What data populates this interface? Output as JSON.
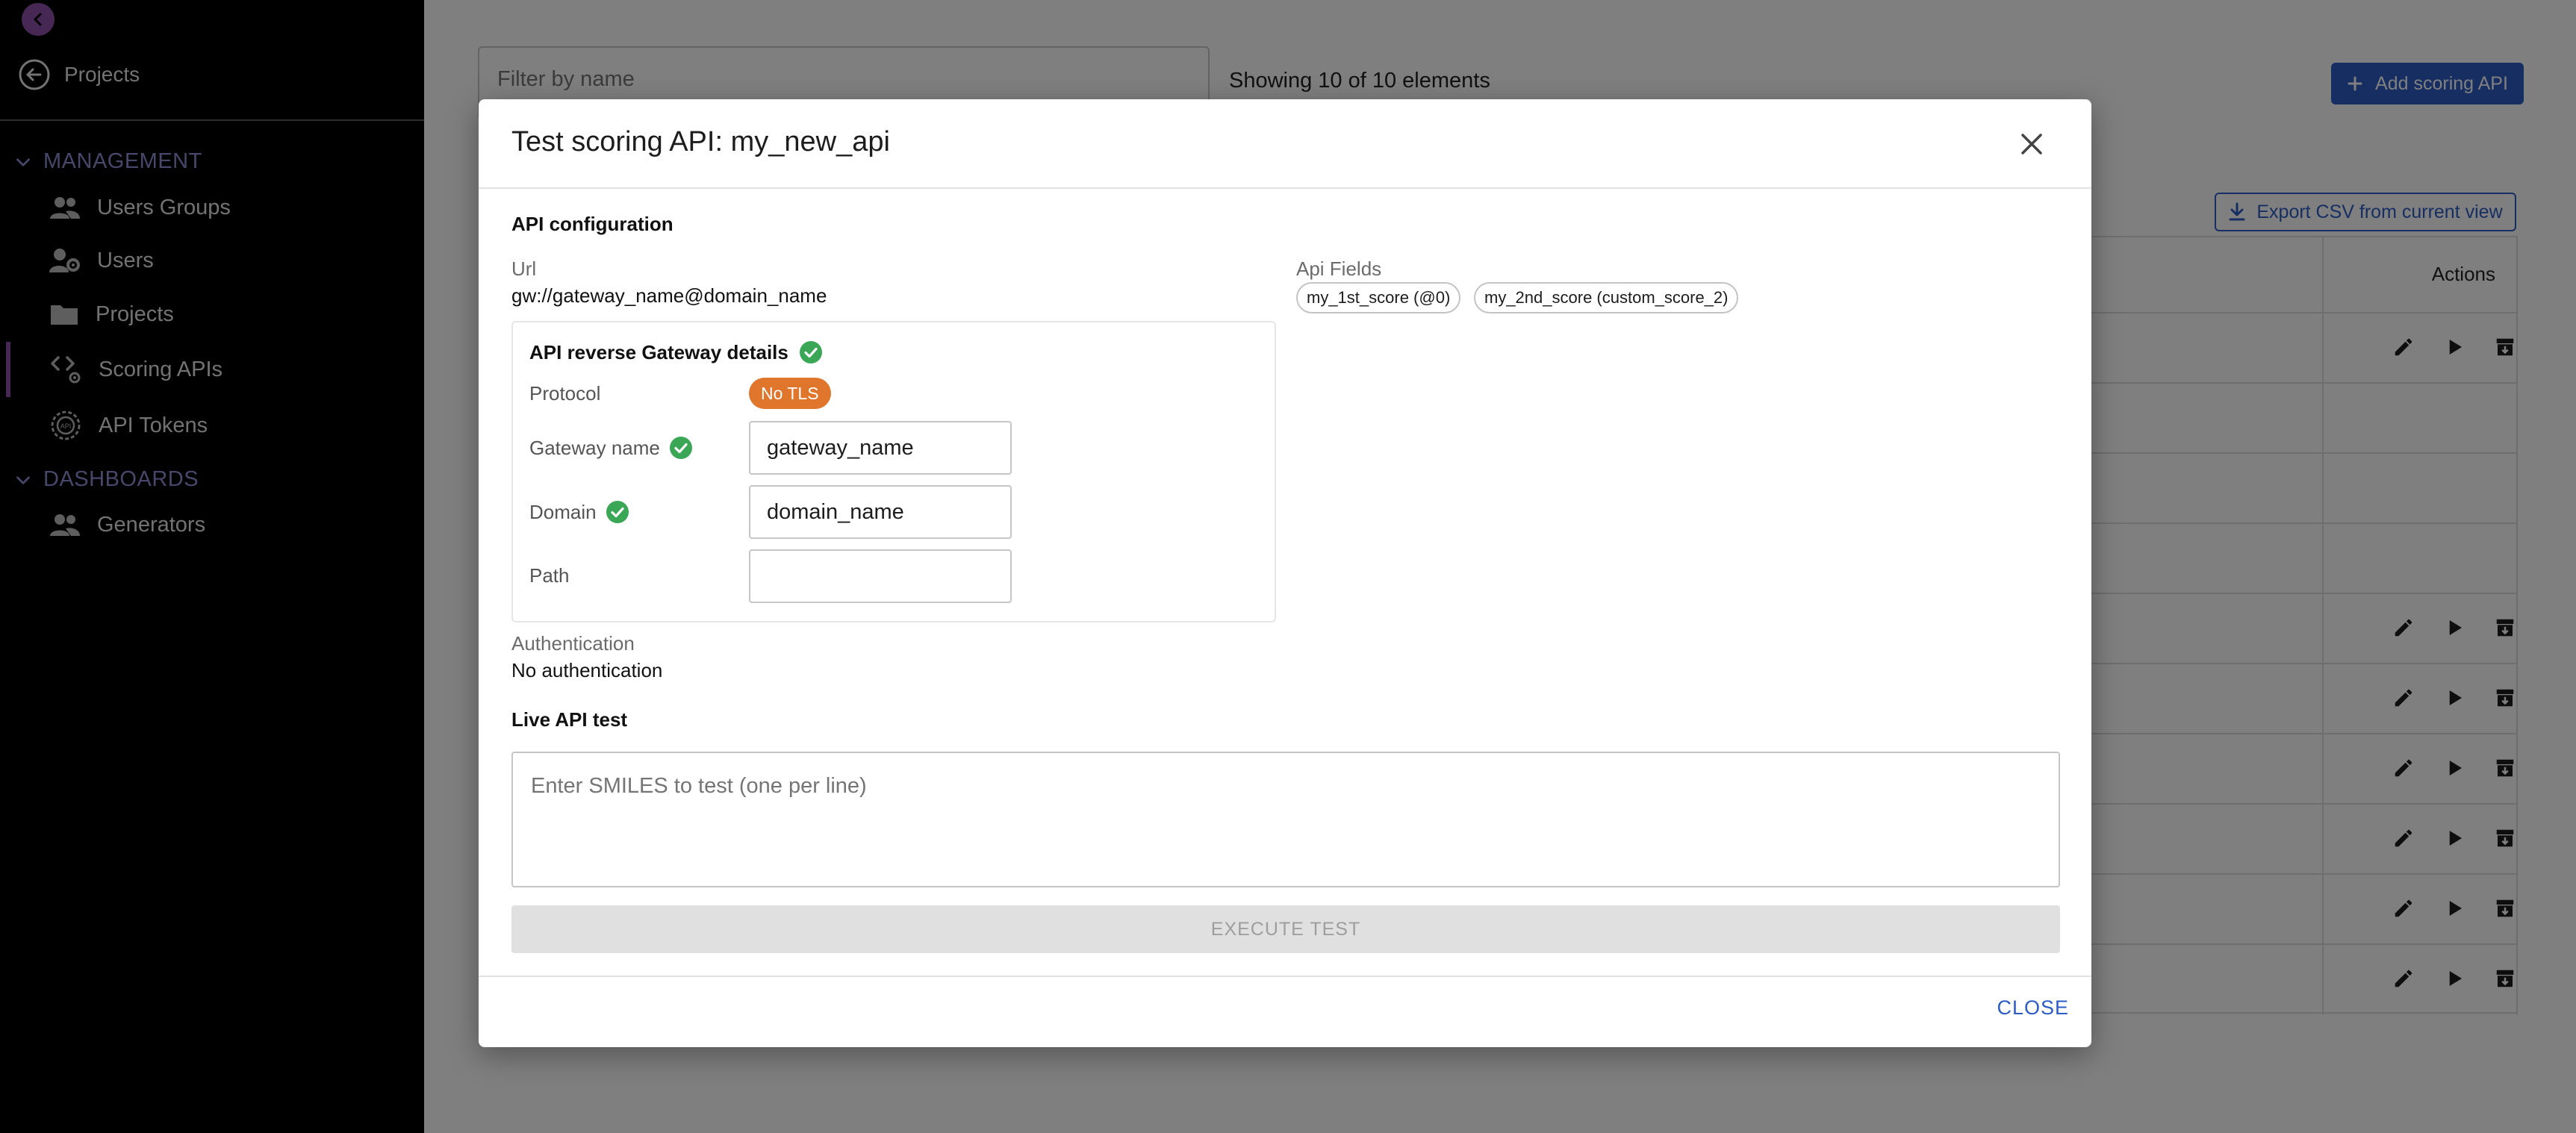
{
  "sidebar": {
    "back_label": "Projects",
    "sections": [
      {
        "label": "MANAGEMENT",
        "items": [
          "Users Groups",
          "Users",
          "Projects",
          "Scoring APIs",
          "API Tokens"
        ]
      },
      {
        "label": "DASHBOARDS",
        "items": [
          "Generators"
        ]
      }
    ],
    "active_item": "Scoring APIs",
    "accent_color": "#8e4ea8"
  },
  "main": {
    "filter_placeholder": "Filter by name",
    "showing_text": "Showing 10 of 10 elements",
    "add_button_label": "Add scoring API",
    "export_button_label": "Export CSV from current view",
    "actions_header": "Actions"
  },
  "modal": {
    "title": "Test scoring API: my_new_api",
    "api_config_heading": "API configuration",
    "url_label": "Url",
    "url_value": "gw://gateway_name@domain_name",
    "api_fields_label": "Api Fields",
    "api_fields": [
      "my_1st_score (@0)",
      "my_2nd_score (custom_score_2)"
    ],
    "gateway": {
      "title": "API reverse Gateway details",
      "protocol_label": "Protocol",
      "protocol_badge": "No TLS",
      "gateway_name_label": "Gateway name",
      "gateway_name_value": "gateway_name",
      "domain_label": "Domain",
      "domain_value": "domain_name",
      "path_label": "Path",
      "path_value": ""
    },
    "auth_label": "Authentication",
    "auth_value": "No authentication",
    "live_test_heading": "Live API test",
    "smiles_placeholder": "Enter SMILES to test (one per line)",
    "execute_label": "EXECUTE TEST",
    "close_label": "CLOSE"
  }
}
